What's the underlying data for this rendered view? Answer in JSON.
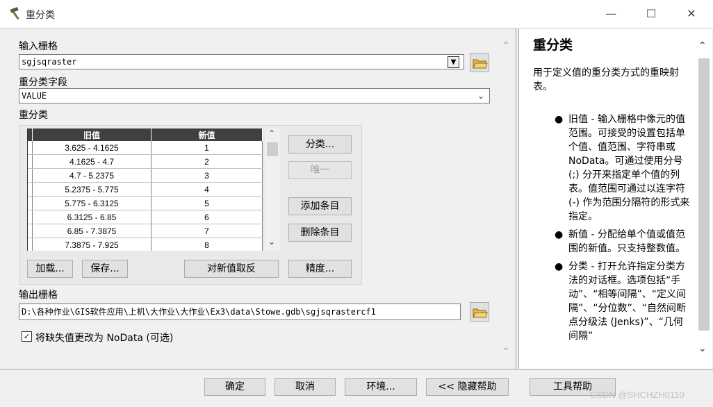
{
  "window": {
    "title": "重分类",
    "icon": "hammer-icon",
    "min_icon": "minimize-icon",
    "max_icon": "maximize-icon",
    "close_icon": "close-icon"
  },
  "form": {
    "input_raster_label": "输入栅格",
    "input_raster_value": "sgjsqraster",
    "reclass_field_label": "重分类字段",
    "reclass_field_value": "VALUE",
    "reclass_label": "重分类",
    "table": {
      "headers": [
        "旧值",
        "新值"
      ],
      "rows": [
        {
          "old": "3.625 - 4.1625",
          "new": "1"
        },
        {
          "old": "4.1625 - 4.7",
          "new": "2"
        },
        {
          "old": "4.7 - 5.2375",
          "new": "3"
        },
        {
          "old": "5.2375 - 5.775",
          "new": "4"
        },
        {
          "old": "5.775 - 6.3125",
          "new": "5"
        },
        {
          "old": "6.3125 - 6.85",
          "new": "6"
        },
        {
          "old": "6.85 - 7.3875",
          "new": "7"
        },
        {
          "old": "7.3875 - 7.925",
          "new": "8"
        }
      ]
    },
    "buttons": {
      "classify": "分类...",
      "unique": "唯一",
      "add_entry": "添加条目",
      "delete_entry": "删除条目",
      "load": "加载...",
      "save": "保存...",
      "reverse": "对新值取反",
      "precision": "精度..."
    },
    "output_raster_label": "输出栅格",
    "output_raster_value": "D:\\各种作业\\GIS软件应用\\上机\\大作业\\大作业\\Ex3\\data\\Stowe.gdb\\sgjsqrastercf1",
    "nodata_checkbox_label": "将缺失值更改为 NoData (可选)",
    "nodata_checked": true
  },
  "bottom_buttons": {
    "ok": "确定",
    "cancel": "取消",
    "env": "环境...",
    "hide_help": "<< 隐藏帮助",
    "tool_help": "工具帮助"
  },
  "help": {
    "title": "重分类",
    "intro": "用于定义值的重分类方式的重映射表。",
    "items": [
      "旧值 - 输入栅格中像元的值范围。可接受的设置包括单个值、值范围、字符串或 NoData。可通过使用分号 (;) 分开来指定单个值的列表。值范围可通过以连字符 (-) 作为范围分隔符的形式来指定。",
      "新值 - 分配给单个值或值范围的新值。只支持整数值。",
      "分类 - 打开允许指定分类方法的对话框。选项包括“手动”、“相等间隔”、“定义间隔”、“分位数”、“自然间断点分级法 (Jenks)”、“几何间隔”"
    ]
  },
  "watermark": "CSDN @SHCHZH0110"
}
